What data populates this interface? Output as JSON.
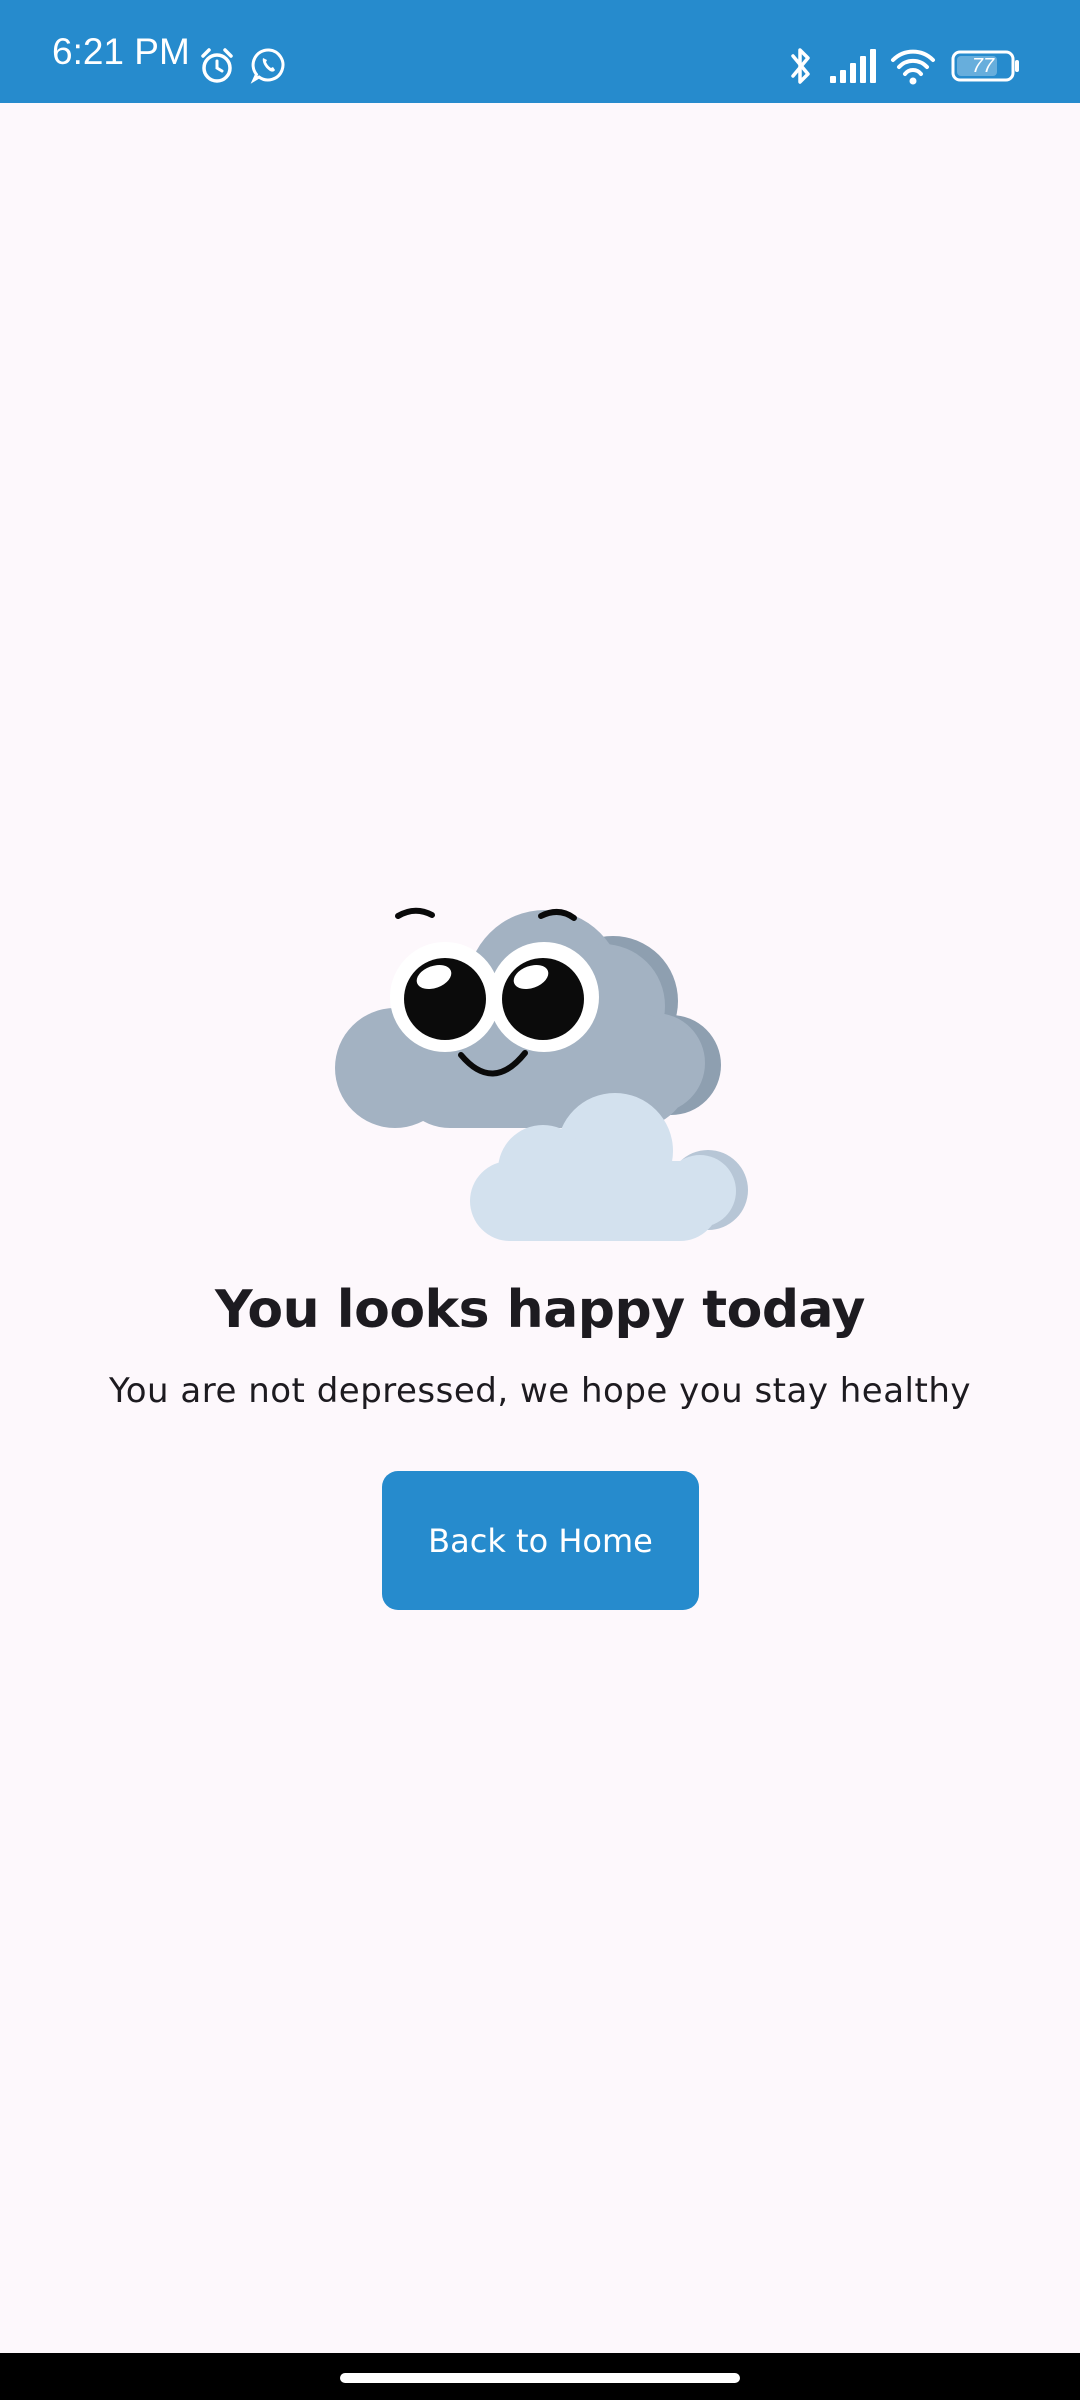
{
  "status_bar": {
    "time": "6:21 PM",
    "left_icons": [
      "alarm-icon",
      "whatsapp-icon"
    ],
    "right_icons": [
      "bluetooth-icon",
      "signal-icon",
      "wifi-icon",
      "battery-icon"
    ],
    "battery_level": "77",
    "background_color": "#268bcd"
  },
  "result": {
    "illustration": "happy-cloud-illustration",
    "title": "You looks happy today",
    "subtitle": "You are not depressed, we hope you stay healthy",
    "button_label": "Back to Home",
    "button_color": "#268bcd"
  }
}
